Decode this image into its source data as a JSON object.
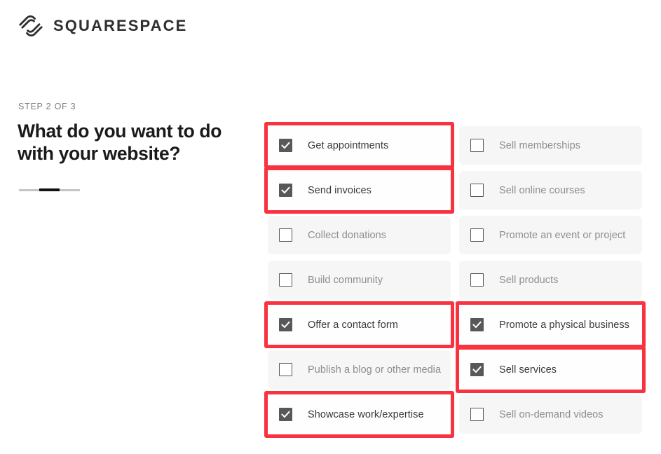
{
  "brand": {
    "name": "SQUARESPACE",
    "logo_icon": "squarespace-logo-icon"
  },
  "wizard": {
    "step_label": "STEP 2 OF 3",
    "headline": "What do you want to do with your website?",
    "progress": {
      "total_steps": 3,
      "current_step": 2,
      "segments": [
        "inactive",
        "active",
        "inactive"
      ]
    }
  },
  "options": {
    "left_column": [
      {
        "label": "Get appointments",
        "checked": true,
        "highlighted": true
      },
      {
        "label": "Send invoices",
        "checked": true,
        "highlighted": true
      },
      {
        "label": "Collect donations",
        "checked": false,
        "highlighted": false
      },
      {
        "label": "Build community",
        "checked": false,
        "highlighted": false
      },
      {
        "label": "Offer a contact form",
        "checked": true,
        "highlighted": true
      },
      {
        "label": "Publish a blog or other media",
        "checked": false,
        "highlighted": false
      },
      {
        "label": "Showcase work/expertise",
        "checked": true,
        "highlighted": true
      }
    ],
    "right_column": [
      {
        "label": "Sell memberships",
        "checked": false,
        "highlighted": false
      },
      {
        "label": "Sell online courses",
        "checked": false,
        "highlighted": false
      },
      {
        "label": "Promote an event or project",
        "checked": false,
        "highlighted": false
      },
      {
        "label": "Sell products",
        "checked": false,
        "highlighted": false
      },
      {
        "label": "Promote a physical business",
        "checked": true,
        "highlighted": true
      },
      {
        "label": "Sell services",
        "checked": true,
        "highlighted": true
      },
      {
        "label": "Sell on-demand videos",
        "checked": false,
        "highlighted": false
      }
    ]
  },
  "colors": {
    "highlight_red": "#f8323f",
    "row_background": "#f6f6f6",
    "checkbox_checked": "#585858",
    "label_muted": "#8d8d8d",
    "label_active": "#3a3a3a",
    "progress_active": "#111111",
    "progress_inactive": "#c4c4c4"
  }
}
